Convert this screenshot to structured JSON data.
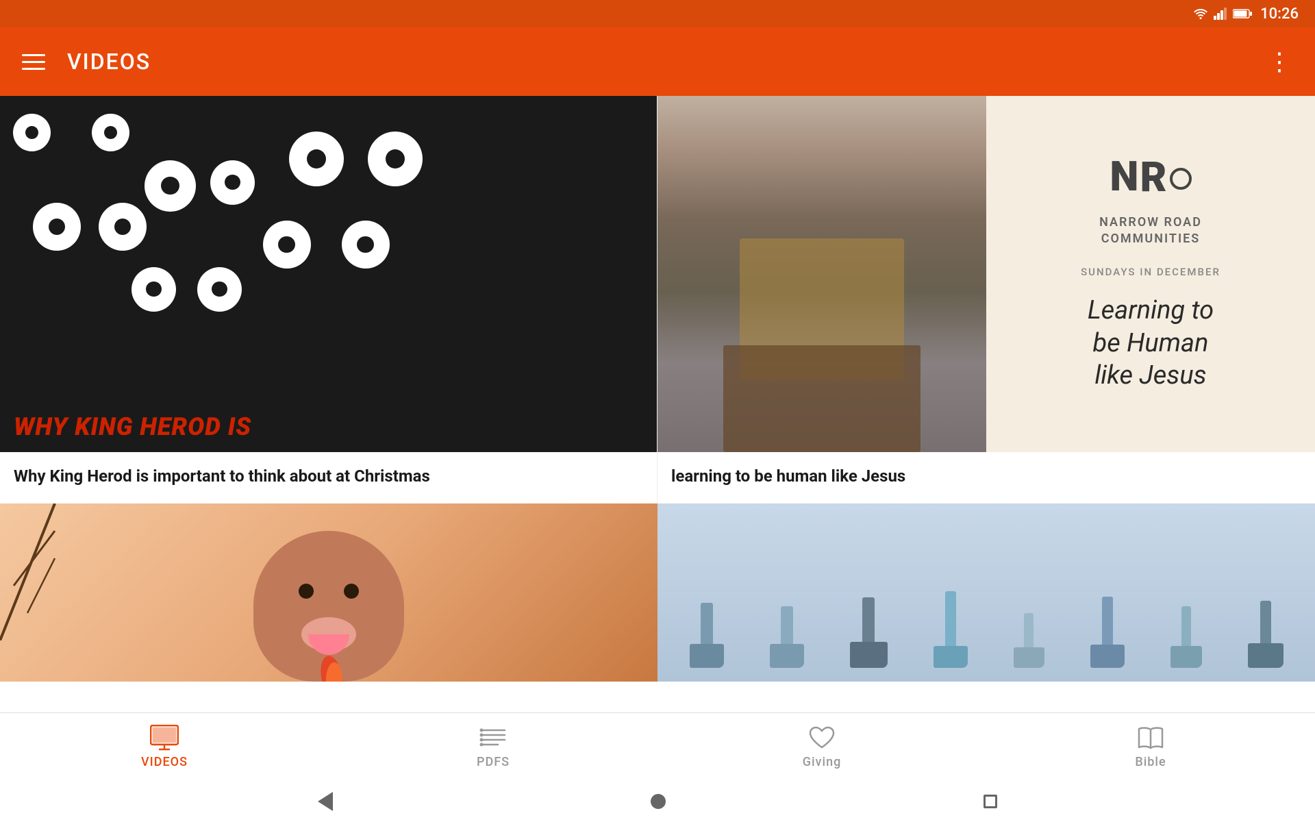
{
  "statusBar": {
    "time": "10:26",
    "icons": [
      "wifi",
      "signal",
      "battery"
    ]
  },
  "appBar": {
    "menuLabel": "Menu",
    "title": "VIDEOS",
    "moreLabel": "More options"
  },
  "videos": [
    {
      "id": "video-1",
      "title": "Why King Herod is important to think about at Christmas",
      "thumbnailType": "eyes",
      "overlayText": "WHY KING HEROD IS"
    },
    {
      "id": "video-2",
      "title": "learning to be human like Jesus",
      "thumbnailType": "narrow-road",
      "seriesLabel": "SUNDAYS IN DECEMBER",
      "orgName": "NARROW ROAD\nCOMMUNITIES",
      "mainTitle": "Learning to\nbe Human\nlike Jesus"
    }
  ],
  "bottomNav": {
    "items": [
      {
        "id": "videos",
        "label": "VIDEOS",
        "icon": "monitor",
        "active": true
      },
      {
        "id": "pdfs",
        "label": "PDFS",
        "icon": "list",
        "active": false
      },
      {
        "id": "giving",
        "label": "Giving",
        "icon": "heart",
        "active": false
      },
      {
        "id": "bible",
        "label": "Bible",
        "icon": "book-open",
        "active": false
      }
    ]
  },
  "systemNav": {
    "back": "Back",
    "home": "Home",
    "recents": "Recents"
  }
}
